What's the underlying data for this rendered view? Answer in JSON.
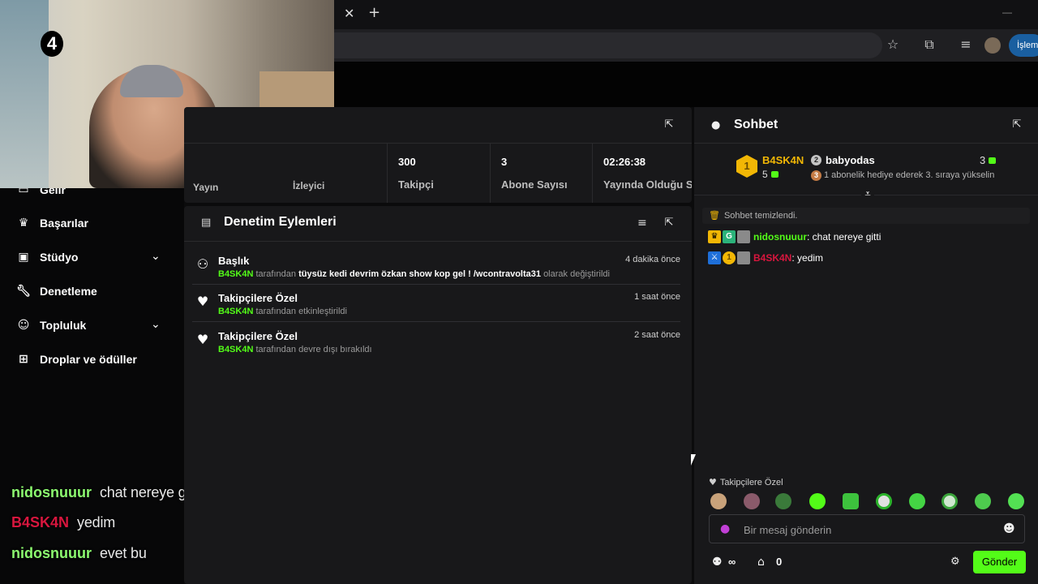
{
  "browser": {
    "profile_button": "İşlem"
  },
  "webcam": {
    "overlay_number": "4"
  },
  "sidebar": {
    "items": [
      {
        "label": "Gelir",
        "icon": "wallet-icon"
      },
      {
        "label": "Başarılar",
        "icon": "trophy-icon"
      },
      {
        "label": "Stüdyo",
        "icon": "studio-icon"
      },
      {
        "label": "Denetleme",
        "icon": "wrench-icon"
      },
      {
        "label": "Topluluk",
        "icon": "community-icon"
      },
      {
        "label": "Droplar ve ödüller",
        "icon": "drops-icon"
      }
    ]
  },
  "stream_overlay": {
    "messages": [
      {
        "user": "nidosnuuur",
        "text": "chat nereye gitti",
        "color": "#8dfc70"
      },
      {
        "user": "B4SK4N",
        "text": "yedim",
        "color": "#d8163e"
      },
      {
        "user": "nidosnuuur",
        "text": "evet bu",
        "color": "#8dfc70"
      }
    ]
  },
  "stats": {
    "partial_label_1": "Yayın",
    "partial_label_2": "İzleyici",
    "items": [
      {
        "value": "300",
        "label": "Takipçi"
      },
      {
        "value": "3",
        "label": "Abone Sayısı"
      },
      {
        "value": "02:26:38",
        "label": "Yayında Olduğu Süre"
      }
    ]
  },
  "moderation": {
    "title": "Denetim Eylemleri",
    "actions": [
      {
        "title": "Başlık",
        "time": "4 dakika önce",
        "user": "B4SK4N",
        "by": "tarafından",
        "value": "tüysüz kedi devrim özkan show kop gel ! /wcontravolta31",
        "result": "olarak değiştirildi",
        "icon": "user-edit-icon"
      },
      {
        "title": "Takipçilere Özel",
        "time": "1 saat önce",
        "user": "B4SK4N",
        "by": "tarafından",
        "result": "etkinleştirildi",
        "icon": "heart-icon"
      },
      {
        "title": "Takipçilere Özel",
        "time": "2 saat önce",
        "user": "B4SK4N",
        "by": "tarafından",
        "result": "devre dışı bırakıldı",
        "icon": "heart-icon"
      }
    ]
  },
  "chat": {
    "title": "Sohbet",
    "leaderboard": {
      "first": {
        "rank": "1",
        "name": "B4SK4N",
        "count": "5"
      },
      "second": {
        "rank": "2",
        "name": "babyodas",
        "count": "3"
      },
      "third": {
        "rank": "3",
        "text": "1 abonelik hediye ederek 3. sıraya yükselin"
      }
    },
    "system_message": "Sohbet temizlendi.",
    "messages": [
      {
        "user": "nidosnuuur",
        "text": "chat nereye gitti",
        "color": "#53fc18"
      },
      {
        "user": "B4SK4N",
        "text": "yedim",
        "color": "#d8163e"
      }
    ],
    "emote_section": "Takipçilere Özel",
    "input_placeholder": "Bir mesaj gönderin",
    "infinite_label": "∞",
    "store_count": "0",
    "send_label": "Gönder"
  },
  "colors": {
    "kick_green": "#53fc18",
    "panel_bg": "#18181a",
    "gold": "#f2b705"
  }
}
